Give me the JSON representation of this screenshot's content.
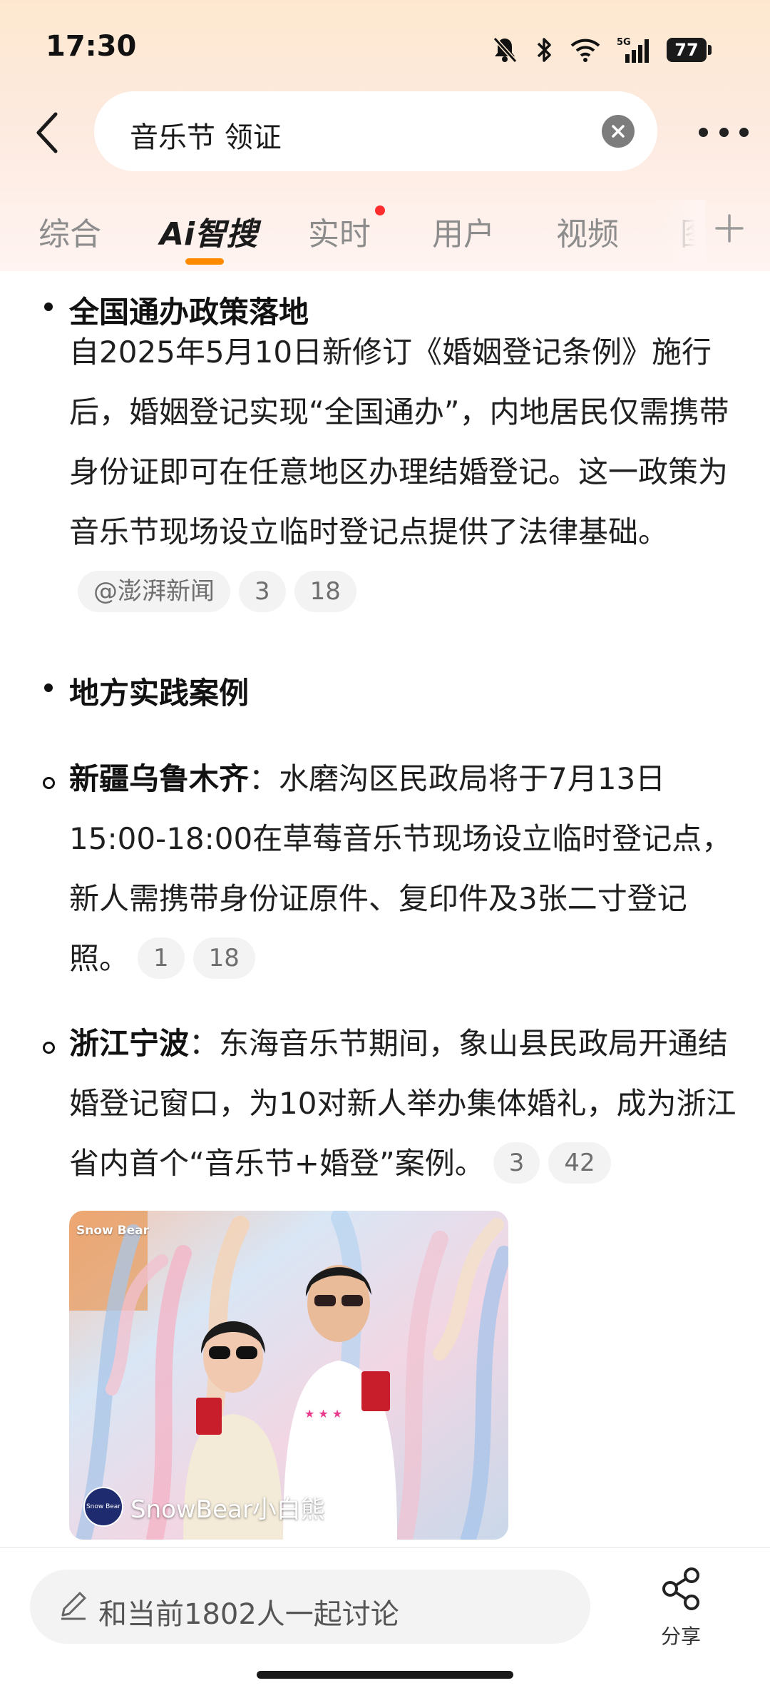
{
  "status_bar": {
    "time": "17:30",
    "battery": "77"
  },
  "search": {
    "query": "音乐节 领证"
  },
  "tabs": [
    {
      "label": "综合"
    },
    {
      "label": "Ai智搜"
    },
    {
      "label": "实时"
    },
    {
      "label": "用户"
    },
    {
      "label": "视频"
    },
    {
      "label": "图"
    }
  ],
  "content": {
    "section1": {
      "heading": "全国通办政策落地",
      "text": "自2025年5月10日新修订《婚姻登记条例》施行后，婚姻登记实现“全国通办”，内地居民仅需携带身份证即可在任意地区办理结婚登记。这一政策为音乐节现场设立临时登记点提供了法律基础。",
      "chips": [
        "@澎湃新闻",
        "3",
        "18"
      ]
    },
    "section2": {
      "heading": "地方实践案例"
    },
    "case1": {
      "title": "新疆乌鲁木齐",
      "text": "：水磨沟区民政局将于7月13日15:00-18:00在草莓音乐节现场设立临时登记点，新人需携带身份证原件、复印件及3张二寸登记照。",
      "chips": [
        "1",
        "18"
      ]
    },
    "case2": {
      "title": "浙江宁波",
      "text": "：东海音乐节期间，象山县民政局开通结婚登记窗口，为10对新人举办集体婚礼，成为浙江省内首个“音乐节+婚登”案例。",
      "chips": [
        "3",
        "42"
      ]
    },
    "image": {
      "watermark_top": "Snow Bear",
      "watermark_bottom": "SnowBear小白熊",
      "logo_text": "Snow Bear"
    }
  },
  "bottom_bar": {
    "discuss_placeholder": "和当前1802人一起讨论",
    "share_label": "分享"
  },
  "colors": {
    "accent": "#ff8a00",
    "notification_dot": "#ff2d2d",
    "background": "#ffffff"
  }
}
